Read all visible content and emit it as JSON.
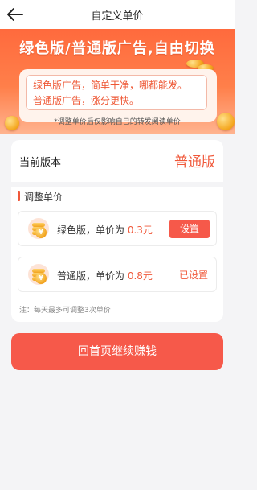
{
  "header": {
    "title": "自定义单价"
  },
  "banner": {
    "headline": "绿色版/普通版广告,自由切换",
    "notice_line1": "绿色版广告，简单干净，哪都能发。",
    "notice_line2": "普通版广告，涨分更快。",
    "note": "*调整单价后仅影响自己的转发阅读单价"
  },
  "current_version": {
    "label": "当前版本",
    "value": "普通版"
  },
  "adjust": {
    "title": "调整单价",
    "rows": [
      {
        "name": "绿色版",
        "price_prefix": "，单价为 ",
        "price": "0.3元",
        "action": "设置"
      },
      {
        "name": "普通版",
        "price_prefix": "，单价为 ",
        "price": "0.8元",
        "action": "已设置"
      }
    ],
    "footnote": "注：每天最多可调整3次单价"
  },
  "cta": {
    "label": "回首页继续赚钱"
  },
  "colors": {
    "accent": "#f0583a",
    "button": "#f6594a",
    "banner_top": "#ff6a3d"
  }
}
